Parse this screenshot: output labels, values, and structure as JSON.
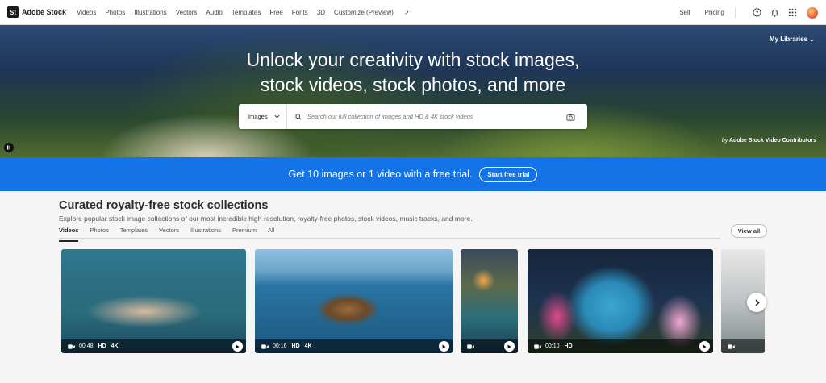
{
  "brand": {
    "badge": "St",
    "name": "Adobe Stock"
  },
  "nav": {
    "links": [
      "Videos",
      "Photos",
      "Illustrations",
      "Vectors",
      "Audio",
      "Templates",
      "Free",
      "Fonts",
      "3D",
      "Customize (Preview)"
    ],
    "sell": "Sell",
    "pricing": "Pricing"
  },
  "hero": {
    "title_line1": "Unlock your creativity with stock images,",
    "title_line2": "stock videos, stock photos, and more",
    "my_libraries": "My Libraries",
    "search": {
      "category": "Images",
      "placeholder": "Search our full collection of images and HD & 4K stock videos"
    },
    "credit_prefix": "by",
    "credit_name": "Adobe Stock Video Contributors"
  },
  "promo": {
    "text": "Get 10 images or 1 video with a free trial.",
    "button": "Start free trial"
  },
  "collections": {
    "title": "Curated royalty-free stock collections",
    "subtitle": "Explore popular stock image collections of our most incredible high-resolution, royalty-free photos, stock videos, music tracks, and more.",
    "tabs": [
      "Videos",
      "Photos",
      "Templates",
      "Vectors",
      "Illustrations",
      "Premium",
      "All"
    ],
    "active_tab": "Videos",
    "view_all": "View all",
    "cards": [
      {
        "duration": "00:48",
        "q1": "HD",
        "q2": "4K"
      },
      {
        "duration": "00:16",
        "q1": "HD",
        "q2": "4K"
      },
      {
        "duration": "",
        "q1": "",
        "q2": ""
      },
      {
        "duration": "00:10",
        "q1": "HD",
        "q2": ""
      },
      {
        "duration": "",
        "q1": "",
        "q2": ""
      }
    ]
  }
}
